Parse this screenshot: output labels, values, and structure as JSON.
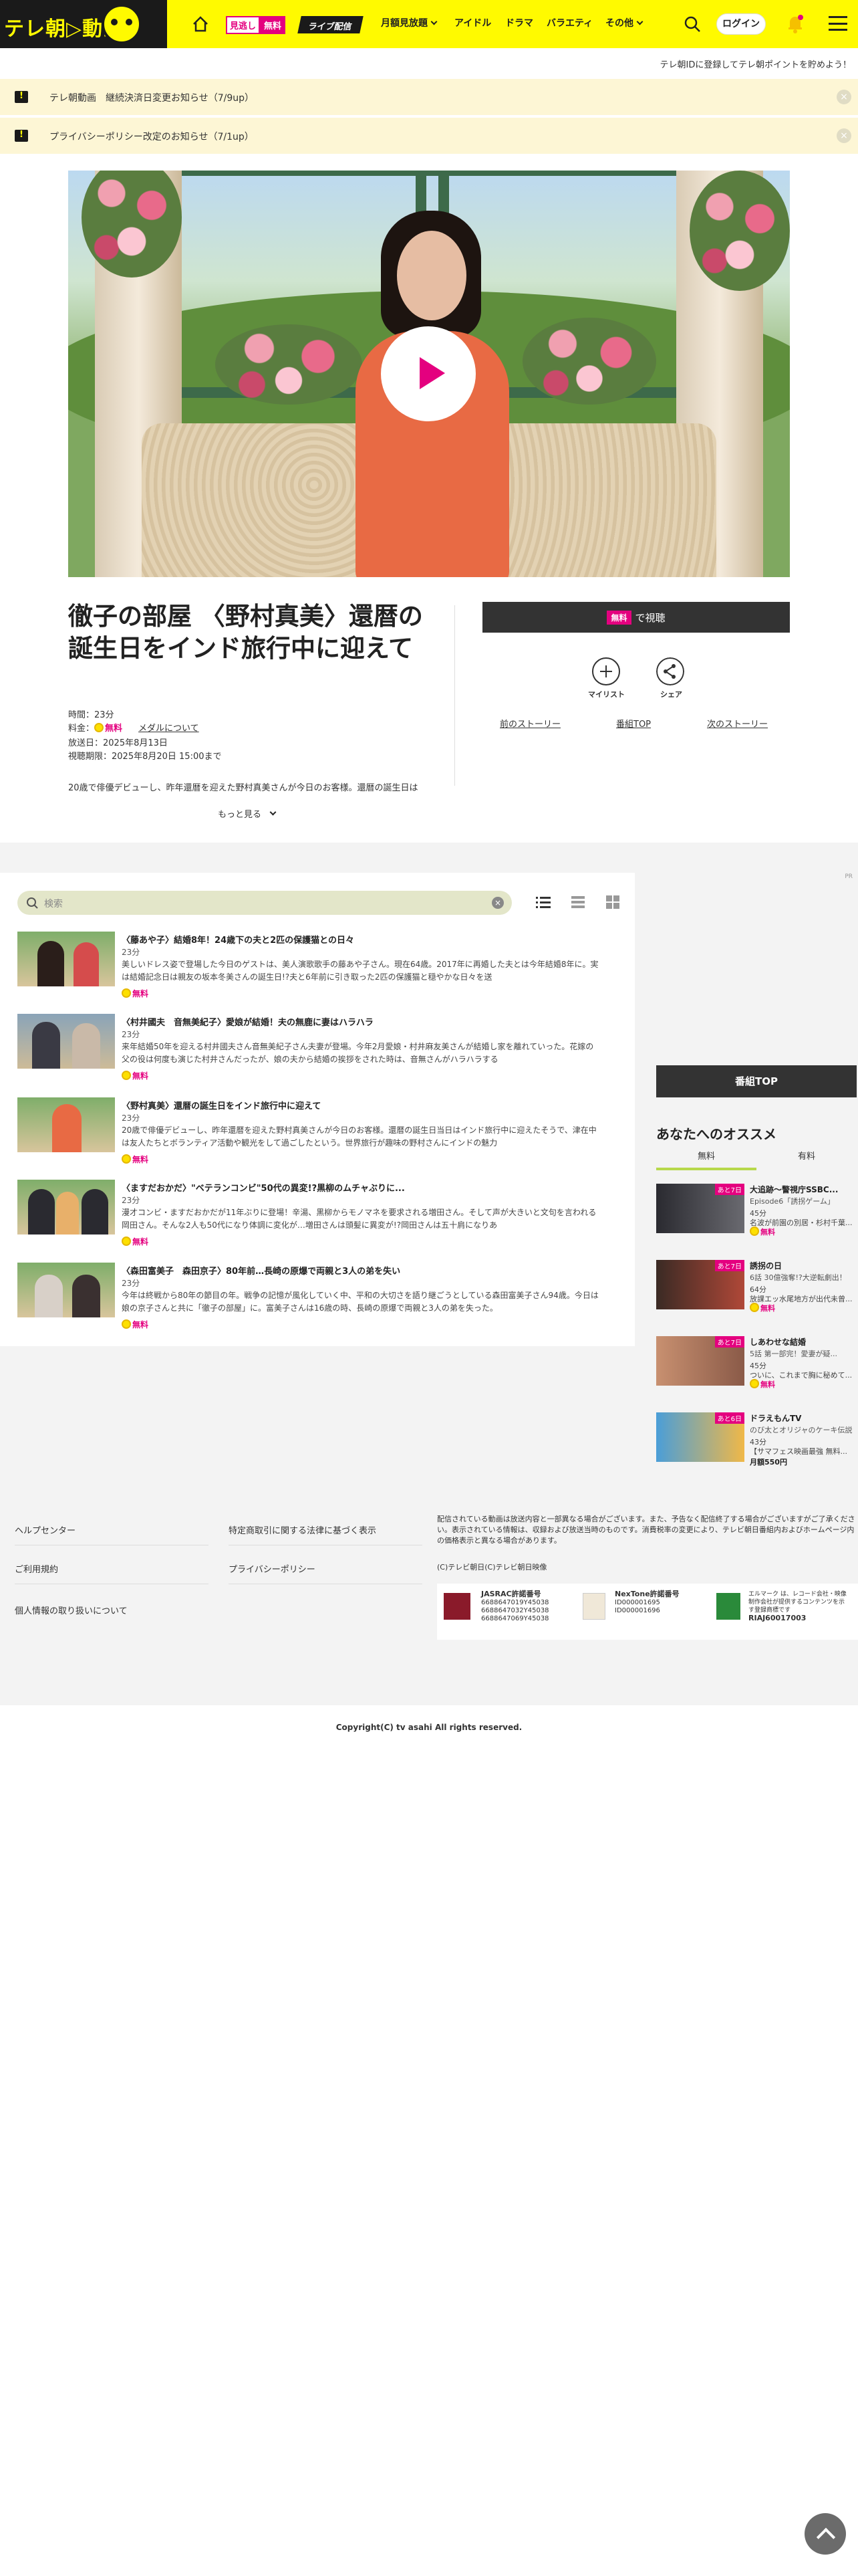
{
  "header": {
    "logo_text": "テレ朝▷動画",
    "free_badge_left": "見逃し",
    "free_badge_right": "無料",
    "live_label": "ライブ配信",
    "nav": [
      "月額見放題",
      "アイドル",
      "ドラマ",
      "バラエティ",
      "その他"
    ],
    "login": "ログイン"
  },
  "sub_notice": "テレ朝IDに登録してテレ朝ポイントを貯めよう！",
  "notices": [
    "テレ朝動画　継続決済日変更お知らせ（7/9up）",
    "プライバシーポリシー改定のお知らせ（7/1up）"
  ],
  "episode": {
    "title": "徹子の部屋 〈野村真美〉還暦の誕生日をインド旅行中に迎えて",
    "duration": "時間：23分",
    "price_label": "料金：",
    "price_free": "無料",
    "medal_link": "メダルについて",
    "broadcast": "放送日：2025年8月13日",
    "deadline": "視聴期限：2025年8月20日 15:00まで",
    "summary": "20歳で俳優デビューし、昨年還暦を迎えた野村真美さんが今日のお客様。還暦の誕生日は",
    "more": "もっと見る",
    "watch_badge": "無料",
    "watch_label": "で視聴",
    "mylist": "マイリスト",
    "share": "シェア",
    "prev": "前のストーリー",
    "top": "番組TOP",
    "next": "次のストーリー"
  },
  "search": {
    "placeholder": "検索"
  },
  "pr_label": "PR",
  "list": [
    {
      "title": "〈藤あや子〉結婚8年！24歳下の夫と2匹の保護猫との日々",
      "dur": "23分",
      "summary": "美しいドレス姿で登場した今日のゲストは、美人演歌歌手の藤あや子さん。現在64歳。2017年に再婚した夫とは今年結婚8年に。実は結婚記念日は親友の坂本冬美さんの誕生日!?夫と6年前に引き取った2匹の保護猫と穏やかな日々を送",
      "free": "無料"
    },
    {
      "title": "〈村井國夫　音無美紀子〉愛娘が結婚！夫の無鹿に妻はハラハラ",
      "dur": "23分",
      "summary": "来年結婚50年を迎える村井國夫さん音無美紀子さん夫妻が登場。今年2月愛娘・村井麻友美さんが結婚し家を離れていった。花嫁の父の役は何度も演じた村井さんだったが、娘の夫から結婚の挨拶をされた時は、音無さんがハラハラする",
      "free": "無料"
    },
    {
      "title": "〈野村真美〉還暦の誕生日をインド旅行中に迎えて",
      "dur": "23分",
      "summary": "20歳で俳優デビューし、昨年還暦を迎えた野村真美さんが今日のお客様。還暦の誕生日当日はインド旅行中に迎えたそうで、津在中は友人たちとボランティア活動や観光をして過ごしたという。世界旅行が趣味の野村さんにインドの魅力",
      "free": "無料"
    },
    {
      "title": "〈ますだおかだ〉\"ベテランコンビ\"50代の異変!?黒柳のムチャぶりに...",
      "dur": "23分",
      "summary": "漫才コンビ・ますだおかだが11年ぶりに登場！辛湯、黒柳からモノマネを要求される増田さん。そして声が大きいと文句を言われる岡田さん。そんな2人も50代になり体調に変化が…増田さんは頭髪に異変が!?岡田さんは五十肩になりあ",
      "free": "無料"
    },
    {
      "title": "〈森田富美子　森田京子〉80年前…長崎の原爆で両親と3人の弟を失い",
      "dur": "23分",
      "summary": "今年は終戦から80年の節目の年。戦争の記憶が風化していく中、平和の大切さを語り継ごうとしている森田富美子さん94歳。今日は娘の京子さんと共に「徹子の部屋」に。富美子さんは16歳の時、長崎の原爆で両親と3人の弟を失った。",
      "free": "無料"
    }
  ],
  "sidebar": {
    "program_top": "番組TOP",
    "reco_title": "あなたへのオススメ",
    "tab_free": "無料",
    "tab_paid": "有料",
    "cards": [
      {
        "tag": "あと7日",
        "title": "大追跡〜警視庁SSBC...",
        "sub": "Episode6「誘拐ゲーム」",
        "dur": "45分",
        "desc": "名波が前園の別居・杉村千葉...",
        "free": "無料"
      },
      {
        "tag": "あと7日",
        "title": "誘拐の日",
        "sub": "6話 30億強奪!?大逆転劇出！",
        "dur": "64分",
        "desc": "放課エッ水尾地方が出代未曾...",
        "free": "無料"
      },
      {
        "tag": "あと7日",
        "title": "しあわせな結婚",
        "sub": "5話 第一部完！愛妻が疑...",
        "dur": "45分",
        "desc": "ついに、これまで胸に秘めて...",
        "free": "無料"
      },
      {
        "tag": "あと6日",
        "title": "ドラえもんTV",
        "sub": "のび太とオリジャのケーキ伝説",
        "dur": "43分",
        "desc": "【サマフェス映画最強 無料...",
        "price": "月額550円"
      }
    ]
  },
  "footer": {
    "links_left": [
      "ヘルプセンター",
      "ご利用規約",
      "個人情報の取り扱いについて"
    ],
    "links_mid": [
      "特定商取引に関する法律に基づく表示",
      "プライバシーポリシー"
    ],
    "legal": "配信されている動画は放送内容と一部異なる場合がございます。また、予告なく配信終了する場合がございますがご了承ください。表示されている情報は、収録および放送当時のものです。消費税率の変更により、テレビ朝日番組内およびホームページ内の価格表示と異なる場合があります。",
    "copyright_small": "(C)テレビ朝日(C)テレビ朝日映像",
    "jasrac_title": "JASRAC許諾番号",
    "jasrac_nums": [
      "6688647019Y45038",
      "6688647032Y45038",
      "6688647069Y45038"
    ],
    "nextone_title": "NexTone許諾番号",
    "nextone_nums": [
      "ID000001695",
      "ID000001696"
    ],
    "riaj_text": "エルマーク は、レコード会社・映像制作会社が提供するコンテンツを示す登録商標です",
    "riaj_num": "RIAJ60017003",
    "copyright": "Copyright(C) tv asahi All rights reserved."
  },
  "colors": {
    "brand_yellow": "#fffa00",
    "accent_pink": "#e4007f",
    "tab_green": "#b7d84b"
  }
}
